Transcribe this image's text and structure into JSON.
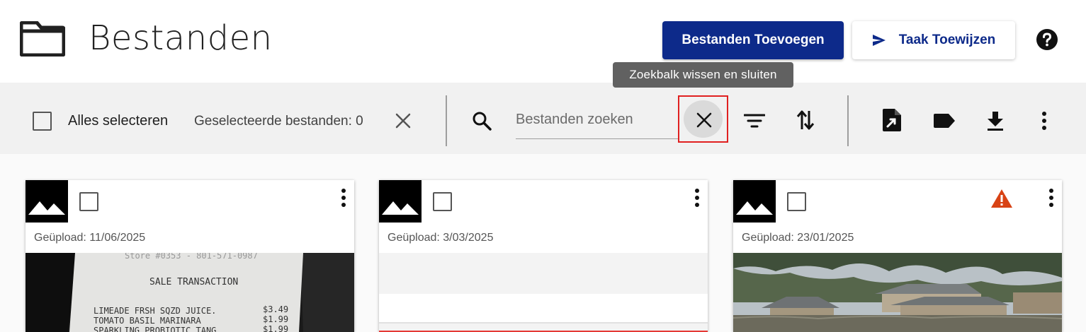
{
  "header": {
    "title": "Bestanden",
    "add_files_label": "Bestanden Toevoegen",
    "assign_task_label": "Taak Toewijzen",
    "icons": {
      "folder": "folder-icon",
      "send": "send-icon",
      "help": "help-icon"
    }
  },
  "tooltip": {
    "text": "Zoekbalk wissen en sluiten"
  },
  "toolbar": {
    "select_all_label": "Alles selecteren",
    "selected_count_text": "Geselecteerde bestanden: 0",
    "search_placeholder": "Bestanden zoeken",
    "search_value": "",
    "icons": [
      "close-icon",
      "search-icon",
      "clear-search-icon",
      "filter-icon",
      "sort-icon",
      "export-file-icon",
      "label-icon",
      "download-icon",
      "more-vert-icon"
    ]
  },
  "cards": [
    {
      "uploaded": "Geüpload: 11/06/2025",
      "preview": "receipt-photo",
      "warning": false,
      "receipt_lines": [
        "SALE TRANSACTION",
        "LIMEADE FRSH SQZD JUICE.",
        "TOMATO BASIL MARINARA",
        "SPARKLING PROBIOTIC TANG",
        "$3.49",
        "$1.99",
        "$1.99"
      ]
    },
    {
      "uploaded": "Geüpload: 3/03/2025",
      "preview": "document-preview",
      "warning": false
    },
    {
      "uploaded": "Geüpload: 23/01/2025",
      "preview": "flood-photo",
      "warning": true
    }
  ],
  "colors": {
    "primary": "#0d2a8a",
    "warning": "#d84315",
    "highlight": "#e02020",
    "toolbar_bg": "#f1f1f1"
  }
}
